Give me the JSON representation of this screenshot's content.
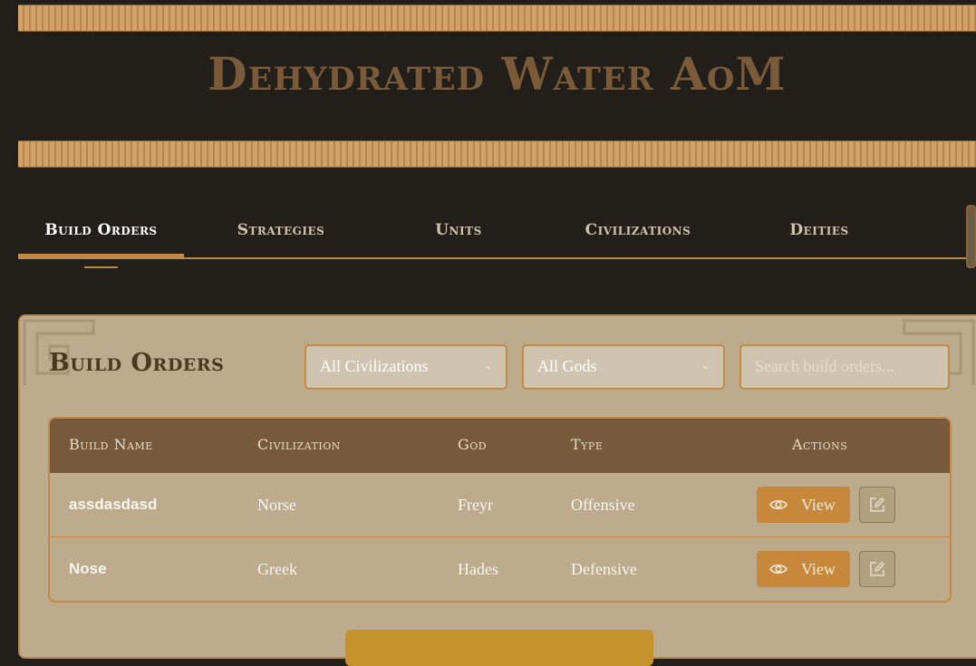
{
  "site": {
    "title": "Dehydrated Water AoM"
  },
  "nav": {
    "tabs": [
      {
        "label": "Build Orders",
        "active": true
      },
      {
        "label": "Strategies"
      },
      {
        "label": "Units"
      },
      {
        "label": "Civilizations"
      },
      {
        "label": "Deities"
      }
    ]
  },
  "panel": {
    "title": "Build Orders",
    "filters": {
      "civilization": "All Civilizations",
      "god": "All Gods",
      "search_placeholder": "Search build orders..."
    },
    "table": {
      "headers": [
        "Build Name",
        "Civilization",
        "God",
        "Type",
        "Actions"
      ],
      "rows": [
        {
          "name": "assdasdasd",
          "civilization": "Norse",
          "god": "Freyr",
          "type": "Offensive",
          "view_label": "View"
        },
        {
          "name": "Nose",
          "civilization": "Greek",
          "god": "Hades",
          "type": "Defensive",
          "view_label": "View"
        }
      ]
    }
  },
  "colors": {
    "accent": "#c7883c",
    "background": "#221f1b",
    "panel": "#bcab8d",
    "header": "#765a3b"
  },
  "icons": {
    "view": "eye-icon",
    "edit": "edit-icon",
    "dropdown": "chevron-down-icon"
  }
}
